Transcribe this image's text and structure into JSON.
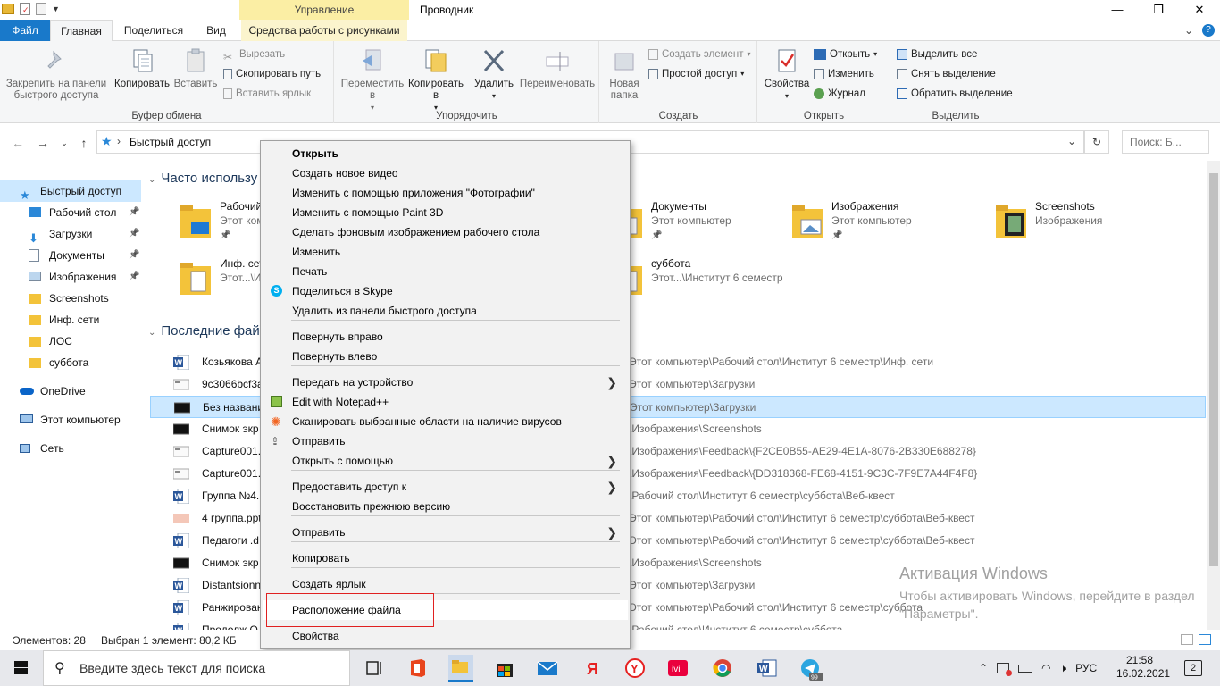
{
  "titlebar": {
    "contextual_group": "Управление",
    "window_title": "Проводник",
    "minimize": "—",
    "maximize": "❐",
    "close": "✕"
  },
  "tabs": {
    "file": "Файл",
    "home": "Главная",
    "share": "Поделиться",
    "view": "Вид",
    "picture_tools": "Средства работы с рисунками"
  },
  "ribbon": {
    "clipboard": {
      "pin": "Закрепить на панели быстрого доступа",
      "copy": "Копировать",
      "paste": "Вставить",
      "cut": "Вырезать",
      "copy_path": "Скопировать путь",
      "paste_shortcut": "Вставить ярлык",
      "label": "Буфер обмена"
    },
    "organize": {
      "move": "Переместить в",
      "copy_to": "Копировать в",
      "delete": "Удалить",
      "rename": "Переименовать",
      "label": "Упорядочить"
    },
    "create": {
      "new_folder": "Новая папка",
      "new_item": "Создать элемент",
      "easy_access": "Простой доступ",
      "label": "Создать"
    },
    "open": {
      "properties": "Свойства",
      "open": "Открыть",
      "edit": "Изменить",
      "history": "Журнал",
      "label": "Открыть"
    },
    "select": {
      "select_all": "Выделить все",
      "select_none": "Снять выделение",
      "invert": "Обратить выделение",
      "label": "Выделить"
    }
  },
  "address": {
    "path": "Быстрый доступ",
    "search_placeholder": "Поиск: Б..."
  },
  "navpane": {
    "items": [
      {
        "label": "Быстрый доступ",
        "pinned": false,
        "selected": true,
        "icon": "star-icon"
      },
      {
        "label": "Рабочий стол",
        "pinned": true,
        "icon": "desktop-icon"
      },
      {
        "label": "Загрузки",
        "pinned": true,
        "icon": "download-icon"
      },
      {
        "label": "Документы",
        "pinned": true,
        "icon": "documents-icon"
      },
      {
        "label": "Изображения",
        "pinned": true,
        "icon": "pictures-icon"
      },
      {
        "label": "Screenshots",
        "pinned": false,
        "icon": "folder-icon"
      },
      {
        "label": "Инф. сети",
        "pinned": false,
        "icon": "folder-icon"
      },
      {
        "label": "ЛОС",
        "pinned": false,
        "icon": "folder-icon"
      },
      {
        "label": "суббота",
        "pinned": false,
        "icon": "folder-icon"
      },
      {
        "label": "OneDrive",
        "pinned": false,
        "icon": "cloud-icon"
      },
      {
        "label": "Этот компьютер",
        "pinned": false,
        "icon": "computer-icon"
      },
      {
        "label": "Сеть",
        "pinned": false,
        "icon": "network-icon"
      }
    ]
  },
  "content": {
    "frequent_header": "Часто использу",
    "recent_header": "Последние фай",
    "frequent": [
      {
        "name": "Рабочий",
        "sub": "Этот комп",
        "pinned": true
      },
      {
        "name": "Документы",
        "sub": "Этот компьютер",
        "pinned": true
      },
      {
        "name": "Изображения",
        "sub": "Этот компьютер",
        "pinned": true
      },
      {
        "name": "Screenshots",
        "sub": "Изображения",
        "pinned": false
      },
      {
        "name": "Инф. сет",
        "sub": "Этот...\\Инс",
        "pinned": false
      },
      {
        "name": "суббота",
        "sub": "Этот...\\Институт 6 семестр",
        "pinned": false
      }
    ],
    "recent": [
      {
        "name": "Козьякова А",
        "path": "Этот компьютер\\Рабочий стол\\Институт 6 семестр\\Инф. сети",
        "type": "word"
      },
      {
        "name": "9c3066bcf3a",
        "path": "Этот компьютер\\Загрузки",
        "type": "image-light"
      },
      {
        "name": "Без названи",
        "path": "Этот компьютер\\Загрузки",
        "type": "image-dark",
        "selected": true
      },
      {
        "name": "Снимок экр",
        "path": "\\Изображения\\Screenshots",
        "type": "image-dark"
      },
      {
        "name": "Capture001.",
        "path": "\\Изображения\\Feedback\\{F2CE0B55-AE29-4E1A-8076-2B330E688278}",
        "type": "image-light"
      },
      {
        "name": "Capture001.",
        "path": "\\Изображения\\Feedback\\{DD318368-FE68-4151-9C3C-7F9E7A44F4F8}",
        "type": "image-light"
      },
      {
        "name": "Группа №4.",
        "path": "\\Рабочий стол\\Институт 6 семестр\\суббота\\Веб-квест",
        "type": "word"
      },
      {
        "name": "4 группа.ppt",
        "path": "Этот компьютер\\Рабочий стол\\Институт 6 семестр\\суббота\\Веб-квест",
        "type": "ppt"
      },
      {
        "name": "Педагоги .d",
        "path": "Этот компьютер\\Рабочий стол\\Институт 6 семестр\\суббота\\Веб-квест",
        "type": "word"
      },
      {
        "name": "Снимок экр",
        "path": "\\Изображения\\Screenshots",
        "type": "image-dark"
      },
      {
        "name": "Distantsionn",
        "path": "Этот компьютер\\Загрузки",
        "type": "word"
      },
      {
        "name": "Ранжирован",
        "path": "Этот компьютер\\Рабочий стол\\Институт 6 семестр\\суббота",
        "type": "word"
      },
      {
        "name": "Продолж О",
        "path": "\\Рабочий стол\\Институт 6 семестр\\суббота",
        "type": "word"
      }
    ]
  },
  "context_menu": {
    "items": [
      {
        "label": "Открыть",
        "bold": true
      },
      {
        "label": "Создать новое видео"
      },
      {
        "label": "Изменить с помощью приложения \"Фотографии\""
      },
      {
        "label": "Изменить с помощью Paint 3D"
      },
      {
        "label": "Сделать фоновым изображением рабочего стола"
      },
      {
        "label": "Изменить"
      },
      {
        "label": "Печать"
      },
      {
        "label": "Поделиться в Skype",
        "icon": "skype-icon"
      },
      {
        "label": "Удалить из панели быстрого доступа"
      },
      {
        "label": "Повернуть вправо"
      },
      {
        "label": "Повернуть влево"
      },
      {
        "label": "Передать на устройство",
        "submenu": true
      },
      {
        "label": "Edit with Notepad++",
        "icon": "notepad-plus-plus-icon"
      },
      {
        "label": "Сканировать выбранные области на наличие вирусов",
        "icon": "avast-icon"
      },
      {
        "label": "Отправить",
        "icon": "share-icon"
      },
      {
        "label": "Открыть с помощью",
        "submenu": true
      },
      {
        "label": "Предоставить доступ к",
        "submenu": true
      },
      {
        "label": "Восстановить прежнюю версию"
      },
      {
        "label": "Отправить",
        "submenu": true
      },
      {
        "label": "Копировать"
      },
      {
        "label": "Создать ярлык"
      },
      {
        "label": "Расположение файла",
        "highlighted": true
      },
      {
        "label": "Свойства"
      }
    ],
    "arrow": "❯"
  },
  "watermark": {
    "title": "Активация Windows",
    "text": "Чтобы активировать Windows, перейдите в раздел \"Параметры\"."
  },
  "statusbar": {
    "count": "Элементов: 28",
    "selection": "Выбран 1 элемент: 80,2 КБ"
  },
  "taskbar": {
    "search_placeholder": "Введите здесь текст для поиска",
    "lang": "РУС",
    "time": "21:58",
    "date": "16.02.2021",
    "notif_count": "2",
    "telegram_badge": "99"
  },
  "colors": {
    "accent": "#1979ca",
    "selection": "#cce8ff",
    "highlight_box": "#e02020",
    "ribbon_bg": "#f5f6f7",
    "context_tab": "#fbeea4"
  }
}
